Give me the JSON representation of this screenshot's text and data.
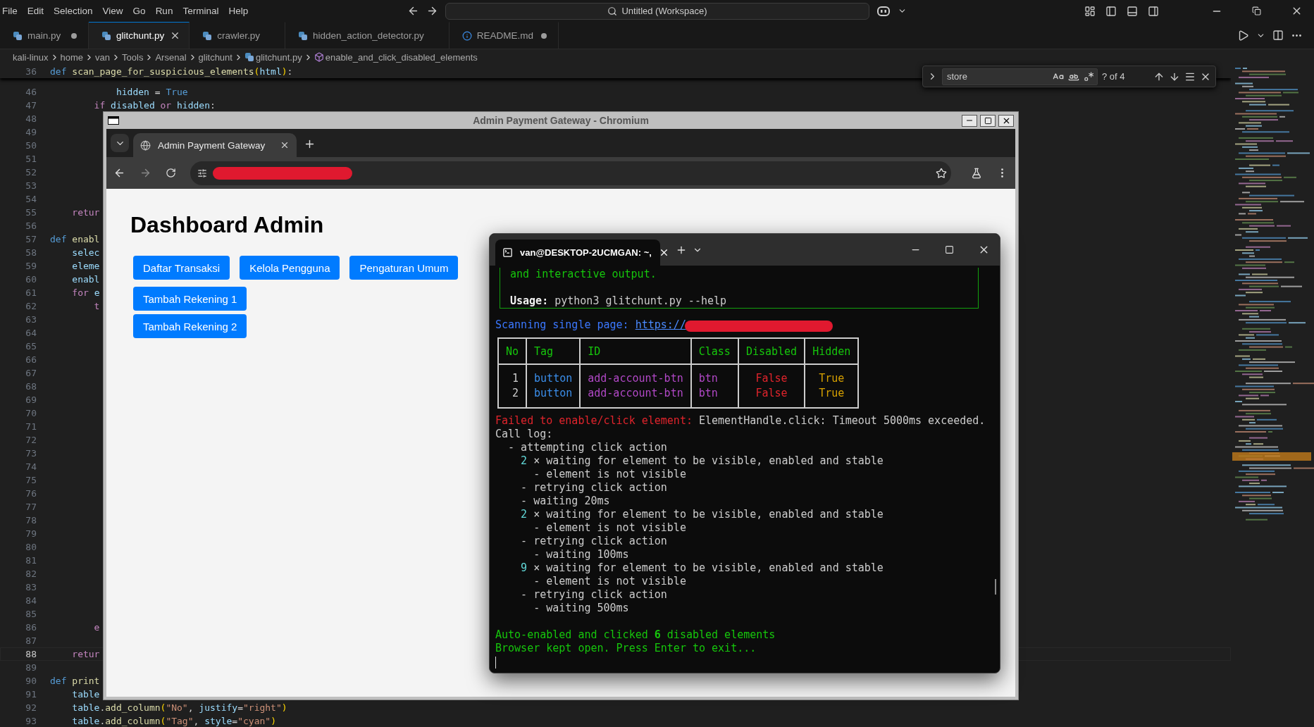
{
  "menu": [
    "File",
    "Edit",
    "Selection",
    "View",
    "Go",
    "Run",
    "Terminal",
    "Help"
  ],
  "command_center": {
    "label": "Untitled (Workspace)"
  },
  "editor_tabs": [
    {
      "label": "main.py",
      "kind": "python",
      "selected": false,
      "modified": true
    },
    {
      "label": "glitchunt.py",
      "kind": "python",
      "selected": true,
      "modified": false
    },
    {
      "label": "crawler.py",
      "kind": "python",
      "selected": false,
      "modified": false
    },
    {
      "label": "hidden_action_detector.py",
      "kind": "python",
      "selected": false,
      "modified": false
    },
    {
      "label": "README.md",
      "kind": "info",
      "selected": false,
      "modified": true
    }
  ],
  "breadcrumbs": [
    {
      "label": "kali-linux",
      "kind": "folder"
    },
    {
      "label": "home",
      "kind": "folder"
    },
    {
      "label": "van",
      "kind": "folder"
    },
    {
      "label": "Tools",
      "kind": "folder"
    },
    {
      "label": "Arsenal",
      "kind": "folder"
    },
    {
      "label": "glitchunt",
      "kind": "folder"
    },
    {
      "label": "glitchunt.py",
      "kind": "python"
    },
    {
      "label": "enable_and_click_disabled_elements",
      "kind": "method"
    }
  ],
  "find_widget": {
    "value": "store",
    "match_count": "? of 4"
  },
  "sticky_line": {
    "number": "36",
    "tokens": [
      {
        "text": "def ",
        "kind": "storage"
      },
      {
        "text": "scan_page_for_suspicious_elements",
        "kind": "func"
      },
      {
        "text": "(",
        "kind": "punc"
      },
      {
        "text": "html",
        "kind": "var"
      },
      {
        "text": ")",
        "kind": "punc"
      },
      {
        "text": ":",
        "kind": "plain"
      }
    ]
  },
  "code_lines": [
    {
      "number": "46",
      "current": false,
      "tokens": [
        {
          "text": "            hidden",
          "kind": "var"
        },
        {
          "text": " = ",
          "kind": "plain"
        },
        {
          "text": "True",
          "kind": "storage"
        }
      ]
    },
    {
      "number": "47",
      "current": false,
      "tokens": [
        {
          "text": "        if ",
          "kind": "ctrl"
        },
        {
          "text": "disabled ",
          "kind": "var"
        },
        {
          "text": "or ",
          "kind": "ctrl"
        },
        {
          "text": "hidden",
          "kind": "var"
        },
        {
          "text": ":",
          "kind": "plain"
        }
      ]
    },
    {
      "number": "48",
      "current": false
    },
    {
      "number": "49",
      "current": false
    },
    {
      "number": "50",
      "current": false
    },
    {
      "number": "51",
      "current": false
    },
    {
      "number": "52",
      "current": false
    },
    {
      "number": "53",
      "current": false
    },
    {
      "number": "54",
      "current": false
    },
    {
      "number": "55",
      "current": false,
      "tokens": [
        {
          "text": "    retur",
          "kind": "ctrl"
        }
      ]
    },
    {
      "number": "56",
      "current": false
    },
    {
      "number": "57",
      "current": false,
      "tokens": [
        {
          "text": "def ",
          "kind": "storage"
        },
        {
          "text": "enabl",
          "kind": "func"
        }
      ]
    },
    {
      "number": "58",
      "current": false,
      "tokens": [
        {
          "text": "    selec",
          "kind": "var"
        }
      ]
    },
    {
      "number": "59",
      "current": false,
      "tokens": [
        {
          "text": "    eleme",
          "kind": "var"
        }
      ]
    },
    {
      "number": "60",
      "current": false,
      "tokens": [
        {
          "text": "    enabl",
          "kind": "var"
        }
      ]
    },
    {
      "number": "61",
      "current": false,
      "tokens": [
        {
          "text": "    for ",
          "kind": "ctrl"
        },
        {
          "text": "e",
          "kind": "var"
        }
      ]
    },
    {
      "number": "62",
      "current": false,
      "tokens": [
        {
          "text": "        t",
          "kind": "ctrl"
        }
      ]
    },
    {
      "number": "63",
      "current": false
    },
    {
      "number": "64",
      "current": false
    },
    {
      "number": "65",
      "current": false
    },
    {
      "number": "66",
      "current": false
    },
    {
      "number": "67",
      "current": false
    },
    {
      "number": "68",
      "current": false
    },
    {
      "number": "69",
      "current": false
    },
    {
      "number": "70",
      "current": false
    },
    {
      "number": "71",
      "current": false
    },
    {
      "number": "72",
      "current": false
    },
    {
      "number": "73",
      "current": false
    },
    {
      "number": "74",
      "current": false
    },
    {
      "number": "75",
      "current": false
    },
    {
      "number": "76",
      "current": false
    },
    {
      "number": "77",
      "current": false
    },
    {
      "number": "78",
      "current": false
    },
    {
      "number": "79",
      "current": false
    },
    {
      "number": "80",
      "current": false
    },
    {
      "number": "81",
      "current": false
    },
    {
      "number": "82",
      "current": false
    },
    {
      "number": "83",
      "current": false
    },
    {
      "number": "84",
      "current": false
    },
    {
      "number": "85",
      "current": false
    },
    {
      "number": "86",
      "current": false,
      "tokens": [
        {
          "text": "        e",
          "kind": "ctrl"
        }
      ]
    },
    {
      "number": "87",
      "current": false
    },
    {
      "number": "88",
      "current": true,
      "tokens": [
        {
          "text": "    retur",
          "kind": "ctrl"
        }
      ]
    },
    {
      "number": "89",
      "current": false
    },
    {
      "number": "90",
      "current": false,
      "tokens": [
        {
          "text": "def ",
          "kind": "storage"
        },
        {
          "text": "print",
          "kind": "func"
        }
      ]
    },
    {
      "number": "91",
      "current": false,
      "tokens": [
        {
          "text": "    table",
          "kind": "var"
        }
      ]
    },
    {
      "number": "92",
      "current": false,
      "tokens": [
        {
          "text": "    table",
          "kind": "var"
        },
        {
          "text": ".",
          "kind": "plain"
        },
        {
          "text": "add_column",
          "kind": "func"
        },
        {
          "text": "(",
          "kind": "punc"
        },
        {
          "text": "\"No\"",
          "kind": "str"
        },
        {
          "text": ", ",
          "kind": "plain"
        },
        {
          "text": "justify",
          "kind": "var"
        },
        {
          "text": "=",
          "kind": "plain"
        },
        {
          "text": "\"right\"",
          "kind": "str"
        },
        {
          "text": ")",
          "kind": "punc"
        }
      ]
    },
    {
      "number": "93",
      "current": false,
      "tokens": [
        {
          "text": "    table",
          "kind": "var"
        },
        {
          "text": ".",
          "kind": "plain"
        },
        {
          "text": "add_column",
          "kind": "func"
        },
        {
          "text": "(",
          "kind": "punc"
        },
        {
          "text": "\"Tag\"",
          "kind": "str"
        },
        {
          "text": ", ",
          "kind": "plain"
        },
        {
          "text": "style",
          "kind": "var"
        },
        {
          "text": "=",
          "kind": "plain"
        },
        {
          "text": "\"cyan\"",
          "kind": "str"
        },
        {
          "text": ")",
          "kind": "punc"
        }
      ]
    }
  ],
  "browser": {
    "window_title": "Admin Payment Gateway - Chromium",
    "tab_title": "Admin Payment Gateway",
    "heading": "Dashboard Admin",
    "button_rows": [
      [
        "Daftar Transaksi",
        "Kelola Pengguna",
        "Pengaturan Umum"
      ],
      [
        "Tambah Rekening 1"
      ],
      [
        "Tambah Rekening 2"
      ]
    ]
  },
  "terminal": {
    "tab_title": "van@DESKTOP-2UCMGAN: ~,",
    "panel_lines": [
      {
        "segments": [
          {
            "text": "and interactive output.",
            "kind": "green"
          }
        ],
        "space_before": false
      },
      {
        "segments": [
          {
            "text": "Usage:",
            "kind": "bold"
          },
          {
            "text": " python3 glitchunt.py --help",
            "kind": "plain"
          }
        ],
        "space_before": true
      }
    ],
    "scan_line": [
      {
        "text": "Scanning single page: ",
        "kind": "blue"
      },
      {
        "text": "https://",
        "kind": "link"
      }
    ],
    "table": {
      "columns": [
        {
          "label": "No",
          "color": "#cccccc"
        },
        {
          "label": "Tag",
          "color": "#3b8eea"
        },
        {
          "label": "ID",
          "color": "#b148c6"
        },
        {
          "label": "Class",
          "color": "#b148c6"
        },
        {
          "label": "Disabled",
          "color": "#e0242c"
        },
        {
          "label": "Hidden",
          "color": "#d6a000"
        }
      ],
      "rows": [
        [
          "1",
          "button",
          "add-account-btn",
          "btn",
          "False",
          "True"
        ],
        [
          "2",
          "button",
          "add-account-btn",
          "btn",
          "False",
          "True"
        ]
      ]
    },
    "log_lines": [
      {
        "segments": [
          {
            "text": "Failed to enable/click element: ",
            "kind": "red"
          },
          {
            "text": "ElementHandle.click: Timeout 5000ms exceeded.",
            "kind": "plain"
          }
        ],
        "space_before": false
      },
      {
        "segments": [
          {
            "text": "Call log:",
            "kind": "plain"
          }
        ],
        "space_before": false
      },
      {
        "segments": [
          {
            "text": "  - attempting click action",
            "kind": "plain"
          }
        ],
        "space_before": false
      },
      {
        "segments": [
          {
            "text": "    2",
            "kind": "cyan"
          },
          {
            "text": " × waiting for element to be visible, enabled and stable",
            "kind": "plain"
          }
        ],
        "space_before": false
      },
      {
        "segments": [
          {
            "text": "      - element is not visible",
            "kind": "plain"
          }
        ],
        "space_before": false
      },
      {
        "segments": [
          {
            "text": "    - retrying click action",
            "kind": "plain"
          }
        ],
        "space_before": false
      },
      {
        "segments": [
          {
            "text": "    - waiting 20ms",
            "kind": "plain"
          }
        ],
        "space_before": false
      },
      {
        "segments": [
          {
            "text": "    2",
            "kind": "cyan"
          },
          {
            "text": " × waiting for element to be visible, enabled and stable",
            "kind": "plain"
          }
        ],
        "space_before": false
      },
      {
        "segments": [
          {
            "text": "      - element is not visible",
            "kind": "plain"
          }
        ],
        "space_before": false
      },
      {
        "segments": [
          {
            "text": "    - retrying click action",
            "kind": "plain"
          }
        ],
        "space_before": false
      },
      {
        "segments": [
          {
            "text": "      - waiting 100ms",
            "kind": "plain"
          }
        ],
        "space_before": false
      },
      {
        "segments": [
          {
            "text": "    9",
            "kind": "cyan"
          },
          {
            "text": " × waiting for element to be visible, enabled and stable",
            "kind": "plain"
          }
        ],
        "space_before": false
      },
      {
        "segments": [
          {
            "text": "      - element is not visible",
            "kind": "plain"
          }
        ],
        "space_before": false
      },
      {
        "segments": [
          {
            "text": "    - retrying click action",
            "kind": "plain"
          }
        ],
        "space_before": false
      },
      {
        "segments": [
          {
            "text": "      - waiting 500ms",
            "kind": "plain"
          }
        ],
        "space_before": false
      },
      {
        "segments": [
          {
            "text": "Auto-enabled and clicked ",
            "kind": "green"
          },
          {
            "text": "6",
            "kind": "greenbold"
          },
          {
            "text": " disabled elements",
            "kind": "green"
          }
        ],
        "space_before": true
      },
      {
        "segments": [
          {
            "text": "Browser kept open. Press Enter to exit...",
            "kind": "green"
          }
        ],
        "space_before": false
      }
    ]
  }
}
